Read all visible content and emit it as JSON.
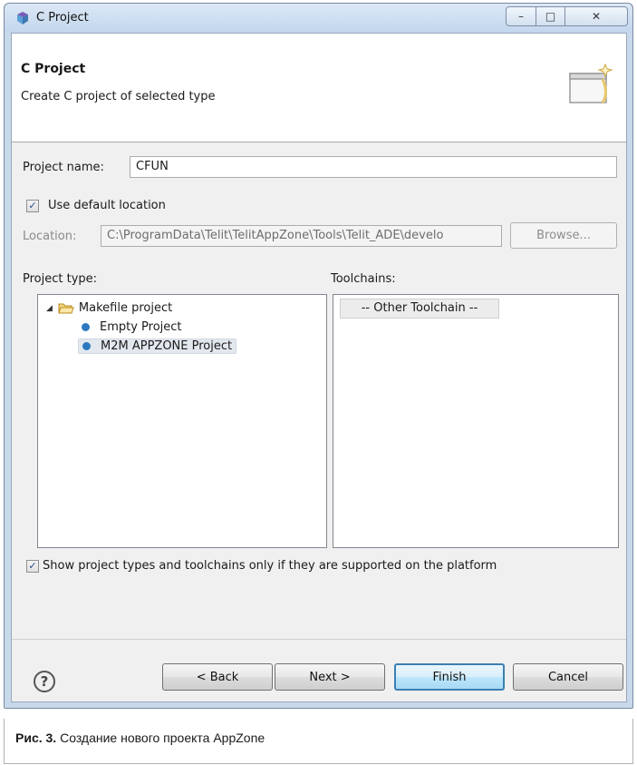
{
  "window": {
    "title": "C Project",
    "controls": {
      "minimize": "–",
      "maximize": "□",
      "close": "✕"
    }
  },
  "banner": {
    "title": "C Project",
    "subtitle": "Create C project of selected type"
  },
  "form": {
    "project_name_label": "Project name:",
    "project_name_value": "CFUN",
    "use_default_location_label": "Use default location",
    "use_default_location_checked": true,
    "location_label": "Location:",
    "location_value": "C:\\ProgramData\\Telit\\TelitAppZone\\Tools\\Telit_ADE\\develo",
    "browse_label": "Browse..."
  },
  "project_type": {
    "header": "Project type:",
    "tree": {
      "root_label": "Makefile project",
      "children": [
        {
          "label": "Empty Project"
        },
        {
          "label": "M2M APPZONE Project",
          "selected": true
        }
      ]
    }
  },
  "toolchains": {
    "header": "Toolchains:",
    "items": [
      "-- Other Toolchain --"
    ]
  },
  "filter": {
    "label": "Show project types and toolchains only if they are supported on the platform",
    "checked": true
  },
  "buttons": {
    "help": "?",
    "back": "< Back",
    "next": "Next >",
    "finish": "Finish",
    "cancel": "Cancel"
  },
  "caption": {
    "bold": "Рис. 3.",
    "text": " Создание нового проекта AppZone"
  },
  "colors": {
    "title_bar": "#c3d6ec",
    "dialog_bg": "#f0f0f0",
    "bullet": "#2d78c0",
    "default_button_border": "#3c7fb1"
  }
}
